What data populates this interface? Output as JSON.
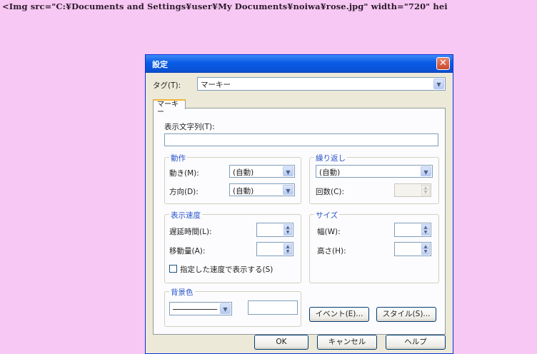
{
  "source_code_line": "<Img src=\"C:¥Documents and Settings¥user¥My Documents¥noiwa¥rose.jpg\" width=\"720\" hei",
  "dialog": {
    "title": "設定",
    "close_symbol": "✕",
    "tag_label": "タグ(T):",
    "tag_value": "マーキー",
    "tab_label": "マーキー",
    "display_text_label": "表示文字列(T):",
    "display_text_value": "",
    "motion_group": {
      "title": "動作",
      "move_label": "動き(M):",
      "move_value": "(自動)",
      "direction_label": "方向(D):",
      "direction_value": "(自動)"
    },
    "repeat_group": {
      "title": "繰り返し",
      "repeat_value": "(自動)",
      "count_label": "回数(C):"
    },
    "speed_group": {
      "title": "表示速度",
      "delay_label": "遅延時間(L):",
      "amount_label": "移動量(A):",
      "checkbox_label": "指定した速度で表示する(S)"
    },
    "size_group": {
      "title": "サイズ",
      "width_label": "幅(W):",
      "height_label": "高さ(H):"
    },
    "background_group": {
      "title": "背景色"
    },
    "event_button": "イベント(E)...",
    "style_button": "スタイル(S)...",
    "ok_button": "OK",
    "cancel_button": "キャンセル",
    "help_button": "ヘルプ"
  },
  "colors": {
    "page_background": "#f7c8f3",
    "title_bar": "#0a5ce6",
    "dialog_face": "#ece9d8",
    "group_title": "#2b55c8"
  }
}
